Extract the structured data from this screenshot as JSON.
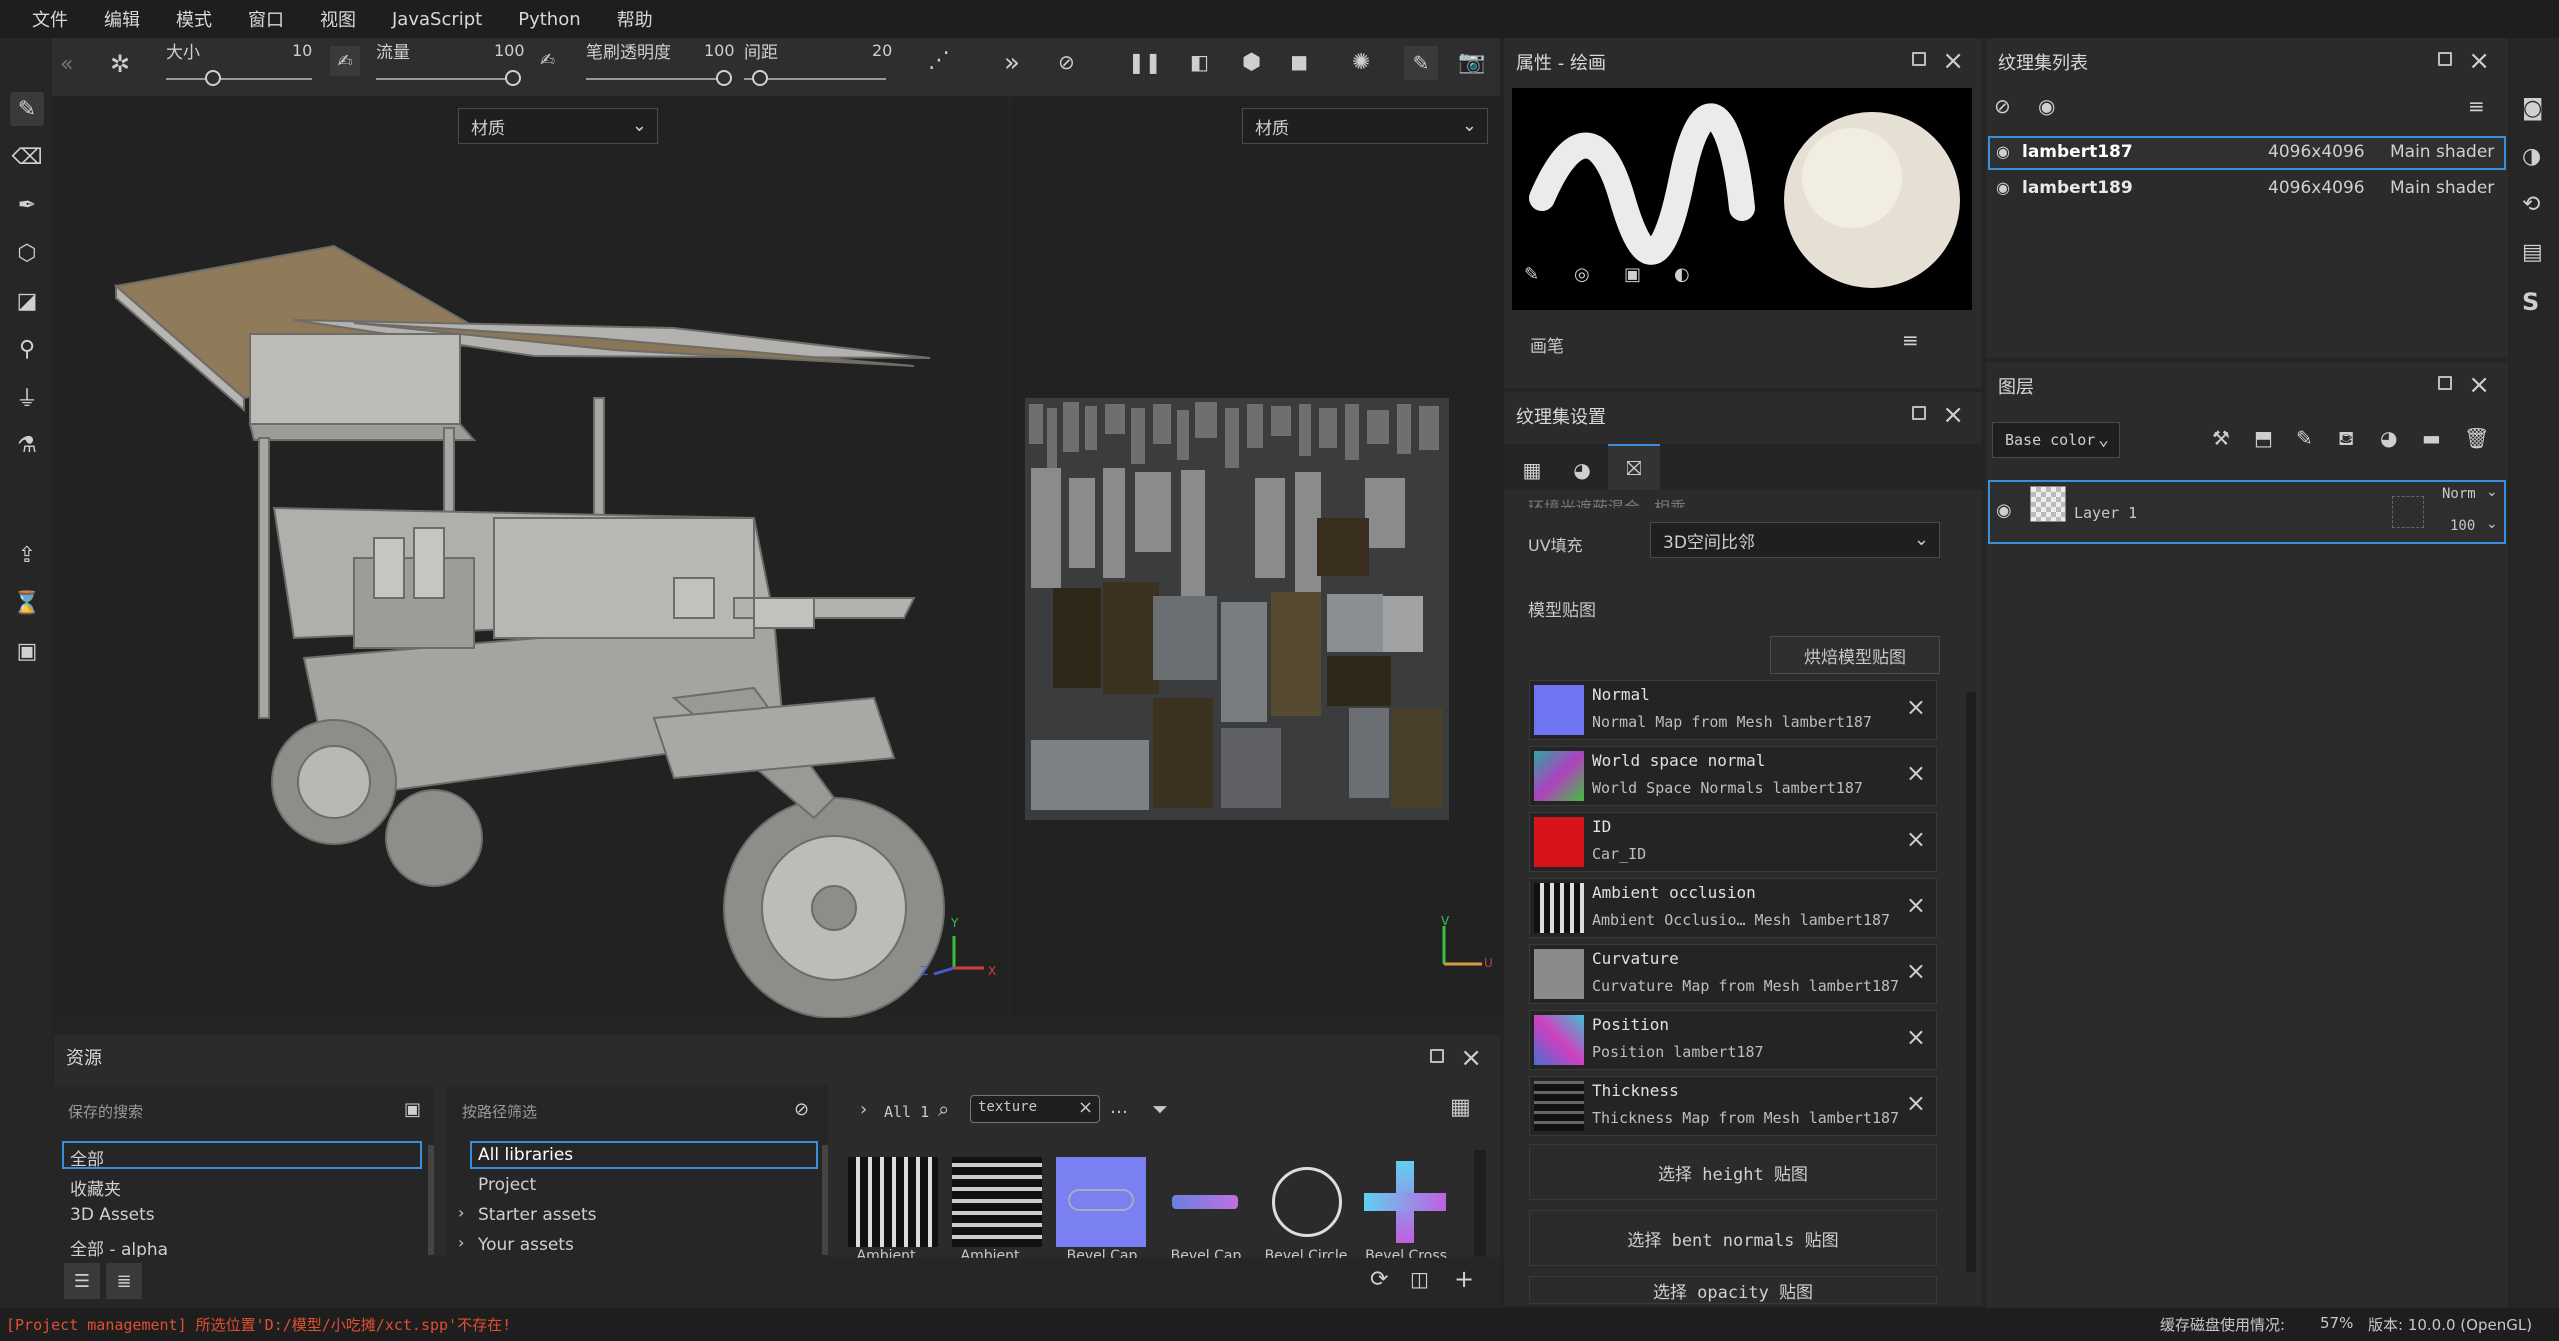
{
  "menu": [
    "文件",
    "编辑",
    "模式",
    "窗口",
    "视图",
    "JavaScript",
    "Python",
    "帮助"
  ],
  "toolbar": {
    "size_label": "大小",
    "size_value": "10",
    "flow_label": "流量",
    "flow_value": "100",
    "opacity_label": "笔刷透明度",
    "opacity_value": "100",
    "spacing_label": "间距",
    "spacing_value": "20"
  },
  "viewport3d": {
    "material_dropdown": "材质",
    "axis_y": "Y",
    "axis_z": "Z",
    "axis_x": "X"
  },
  "viewport2d": {
    "material_dropdown": "材质",
    "axis_v": "V",
    "axis_u": "U"
  },
  "props": {
    "title": "属性 - 绘画",
    "brush_section": "画笔"
  },
  "texset_settings": {
    "title": "纹理集设置",
    "hidden_row": "环境光遮蔽混合",
    "hidden_value": "相乘",
    "uv_label": "UV填充",
    "uv_value": "3D空间比邻",
    "mesh_maps_title": "模型贴图",
    "bake_button": "烘焙模型贴图",
    "maps": [
      {
        "name": "Normal",
        "desc": "Normal Map from Mesh lambert187",
        "color": "#6f74f0"
      },
      {
        "name": "World space normal",
        "desc": "World Space Normals lambert187",
        "color": "#7a4fa0"
      },
      {
        "name": "ID",
        "desc": "Car_ID",
        "color": "#d8141a"
      },
      {
        "name": "Ambient occlusion",
        "desc": "Ambient Occlusio… Mesh lambert187",
        "color": "#777"
      },
      {
        "name": "Curvature",
        "desc": "Curvature Map from Mesh lambert187",
        "color": "#8a8a8a"
      },
      {
        "name": "Position",
        "desc": "Position lambert187",
        "color": "#4a6fd0"
      },
      {
        "name": "Thickness",
        "desc": "Thickness Map from Mesh lambert187",
        "color": "#3a3a3a"
      }
    ],
    "select_height": "选择 height 贴图",
    "select_bent": "选择 bent normals 贴图",
    "select_opacity": "选择 opacity 贴图"
  },
  "texset_list": {
    "title": "纹理集列表",
    "rows": [
      {
        "name": "lambert187",
        "size": "4096x4096",
        "shader": "Main shader"
      },
      {
        "name": "lambert189",
        "size": "4096x4096",
        "shader": "Main shader"
      }
    ]
  },
  "layers": {
    "title": "图层",
    "channel": "Base color",
    "layer_name": "Layer 1",
    "blend": "Norm",
    "opacity": "100"
  },
  "assets": {
    "title": "资源",
    "saved_search": "保存的搜索",
    "path_filter": "按路径筛选",
    "left_list": [
      "全部",
      "收藏夹",
      "3D Assets",
      "全部 - alpha"
    ],
    "mid_list": [
      "All libraries",
      "Project",
      "Starter assets",
      "Your assets"
    ],
    "crumb": "All 1",
    "search_value": "texture",
    "thumbs": [
      "Ambient…",
      "Ambient…",
      "Bevel Cap",
      "Bevel Cap",
      "Bevel Circle",
      "Bevel Cross"
    ]
  },
  "status": {
    "message": "[Project management] 所选位置'D:/模型/小吃摊/xct.spp'不存在!",
    "cache_label": "缓存磁盘使用情况:",
    "cache_value": "57%",
    "version": "版本: 10.0.0 (OpenGL)"
  }
}
